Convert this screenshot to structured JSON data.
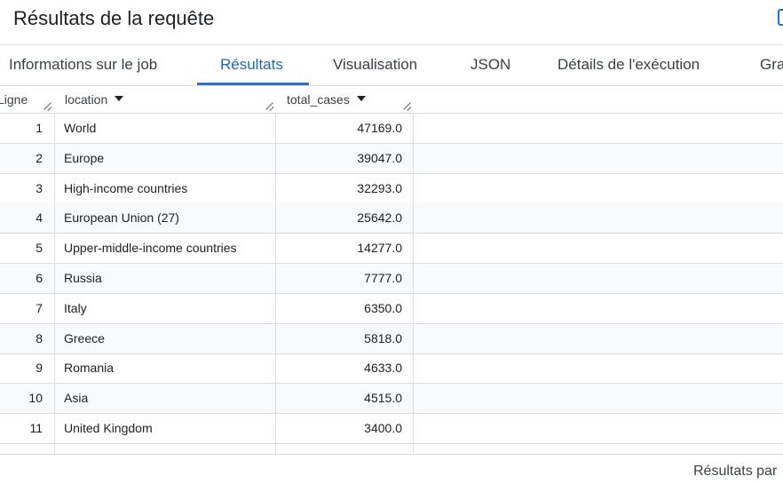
{
  "panel": {
    "title": "Résultats de la requête"
  },
  "tabs": [
    {
      "label": "Informations sur le job",
      "active": false
    },
    {
      "label": "Résultats",
      "active": true
    },
    {
      "label": "Visualisation",
      "active": false
    },
    {
      "label": "JSON",
      "active": false
    },
    {
      "label": "Détails de l'exécution",
      "active": false
    },
    {
      "label": "Gra",
      "active": false
    }
  ],
  "table": {
    "columns": [
      {
        "label": "Ligne"
      },
      {
        "label": "location",
        "sortable": true
      },
      {
        "label": "total_cases",
        "sortable": true
      }
    ],
    "rows": [
      {
        "num": "1",
        "location": "World",
        "total_cases": "47169.0"
      },
      {
        "num": "2",
        "location": "Europe",
        "total_cases": "39047.0"
      },
      {
        "num": "3",
        "location": "High-income countries",
        "total_cases": "32293.0"
      },
      {
        "num": "4",
        "location": "European Union (27)",
        "total_cases": "25642.0"
      },
      {
        "num": "5",
        "location": "Upper-middle-income countries",
        "total_cases": "14277.0"
      },
      {
        "num": "6",
        "location": "Russia",
        "total_cases": "7777.0"
      },
      {
        "num": "7",
        "location": "Italy",
        "total_cases": "6350.0"
      },
      {
        "num": "8",
        "location": "Greece",
        "total_cases": "5818.0"
      },
      {
        "num": "9",
        "location": "Romania",
        "total_cases": "4633.0"
      },
      {
        "num": "10",
        "location": "Asia",
        "total_cases": "4515.0"
      },
      {
        "num": "11",
        "location": "United Kingdom",
        "total_cases": "3400.0"
      }
    ]
  },
  "footer": {
    "pagination_label": "Résultats par"
  },
  "colors": {
    "accent": "#1a73e8",
    "active_tab_text": "#1967d2",
    "border": "#dadce0",
    "alt_row": "#f8f9fa"
  }
}
